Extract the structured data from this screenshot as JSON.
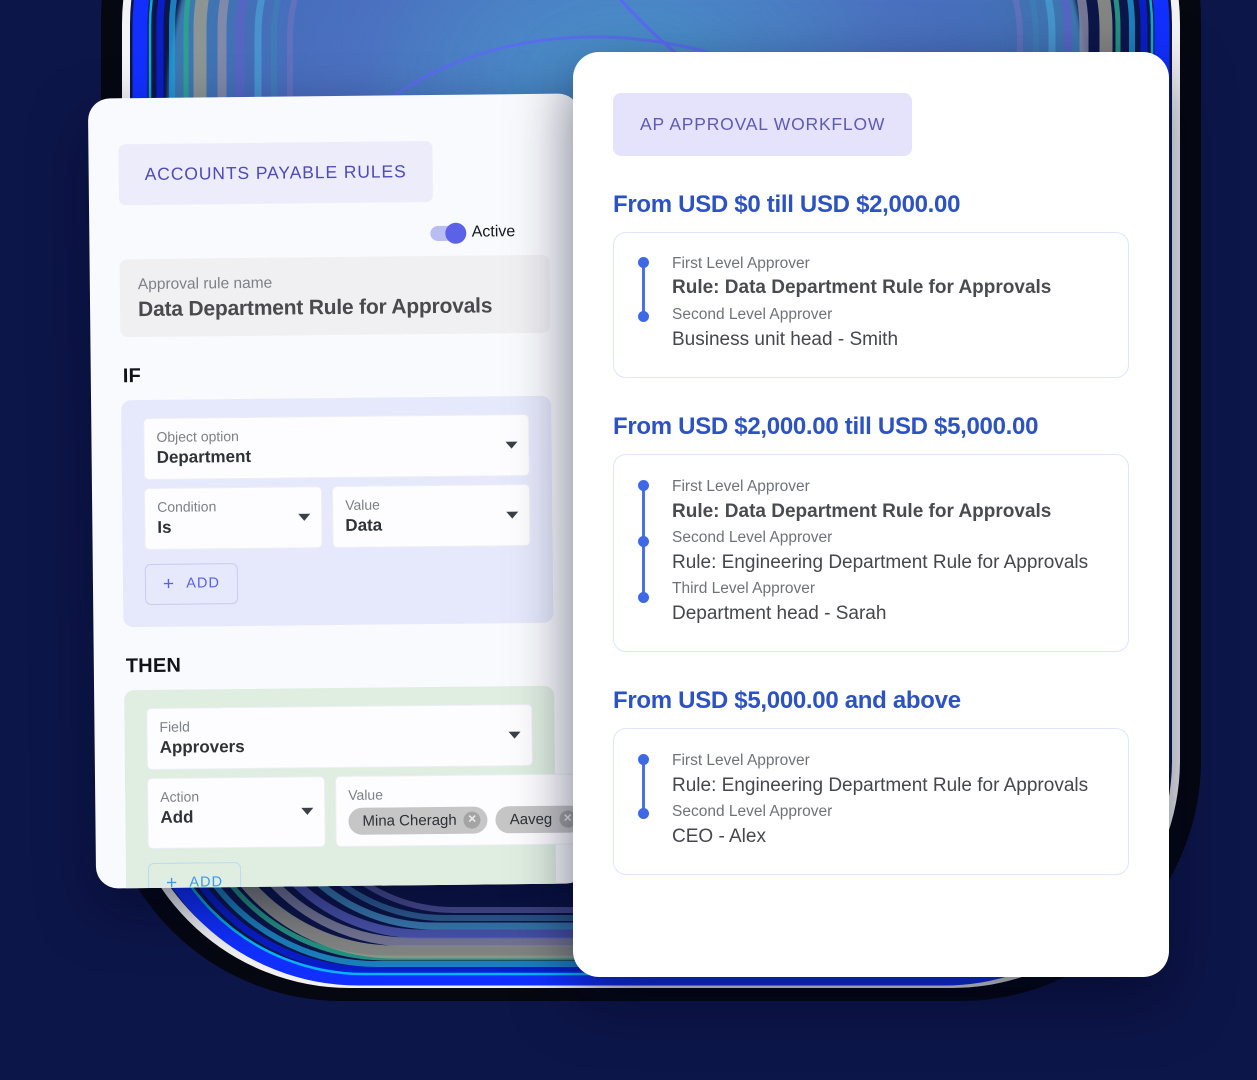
{
  "theme": {
    "background": "#0d1649",
    "accent_indigo": "#5b62e8",
    "accent_blue": "#2d52c4",
    "pill_bg_left": "#ececfb",
    "pill_bg_right": "#e5e2fb",
    "if_bg": "#e6e9fb",
    "then_bg": "#dfeee1",
    "chip_bg": "#c6c6c6"
  },
  "left_panel": {
    "title": "ACCOUNTS PAYABLE RULES",
    "toggle": {
      "label": "Active",
      "state": "on"
    },
    "rule_name_field": {
      "label": "Approval rule name",
      "value": "Data Department Rule for Approvals"
    },
    "if_section": {
      "heading": "IF",
      "fields": [
        {
          "label": "Object option",
          "value": "Department"
        },
        {
          "label": "Condition",
          "value": "Is"
        },
        {
          "label": "Value",
          "value": "Data"
        }
      ],
      "add_button": {
        "plus": "+",
        "label": "ADD"
      }
    },
    "then_section": {
      "heading": "THEN",
      "fields": [
        {
          "label": "Field",
          "value": "Approvers"
        },
        {
          "label": "Action",
          "value": "Add"
        }
      ],
      "value_field": {
        "label": "Value",
        "chips": [
          {
            "text": "Mina Cheragh",
            "remove": "✕"
          },
          {
            "text": "Aaveg",
            "remove": "✕"
          }
        ]
      },
      "add_button": {
        "plus": "+",
        "label": "ADD"
      }
    }
  },
  "right_panel": {
    "title": "AP APPROVAL WORKFLOW",
    "brackets": [
      {
        "heading": "From USD $0 till USD $2,000.00",
        "levels": [
          {
            "label": "First Level Approver",
            "value": "Rule: Data Department Rule for Approvals",
            "bold": true
          },
          {
            "label": "Second Level Approver",
            "value": "Business unit head - Smith",
            "bold": false
          }
        ]
      },
      {
        "heading": "From USD $2,000.00 till USD $5,000.00",
        "levels": [
          {
            "label": "First Level Approver",
            "value": "Rule: Data Department Rule for Approvals",
            "bold": true
          },
          {
            "label": "Second Level Approver",
            "value": "Rule: Engineering Department Rule for Approvals",
            "bold": false
          },
          {
            "label": "Third Level Approver",
            "value": "Department head - Sarah",
            "bold": false
          }
        ]
      },
      {
        "heading": "From USD $5,000.00 and above",
        "levels": [
          {
            "label": "First Level Approver",
            "value": "Rule: Engineering Department Rule for Approvals",
            "bold": false
          },
          {
            "label": "Second Level Approver",
            "value": "CEO - Alex",
            "bold": false
          }
        ]
      }
    ]
  },
  "decor": {
    "arrow": "curved-arrow-pointing-to-panel"
  }
}
